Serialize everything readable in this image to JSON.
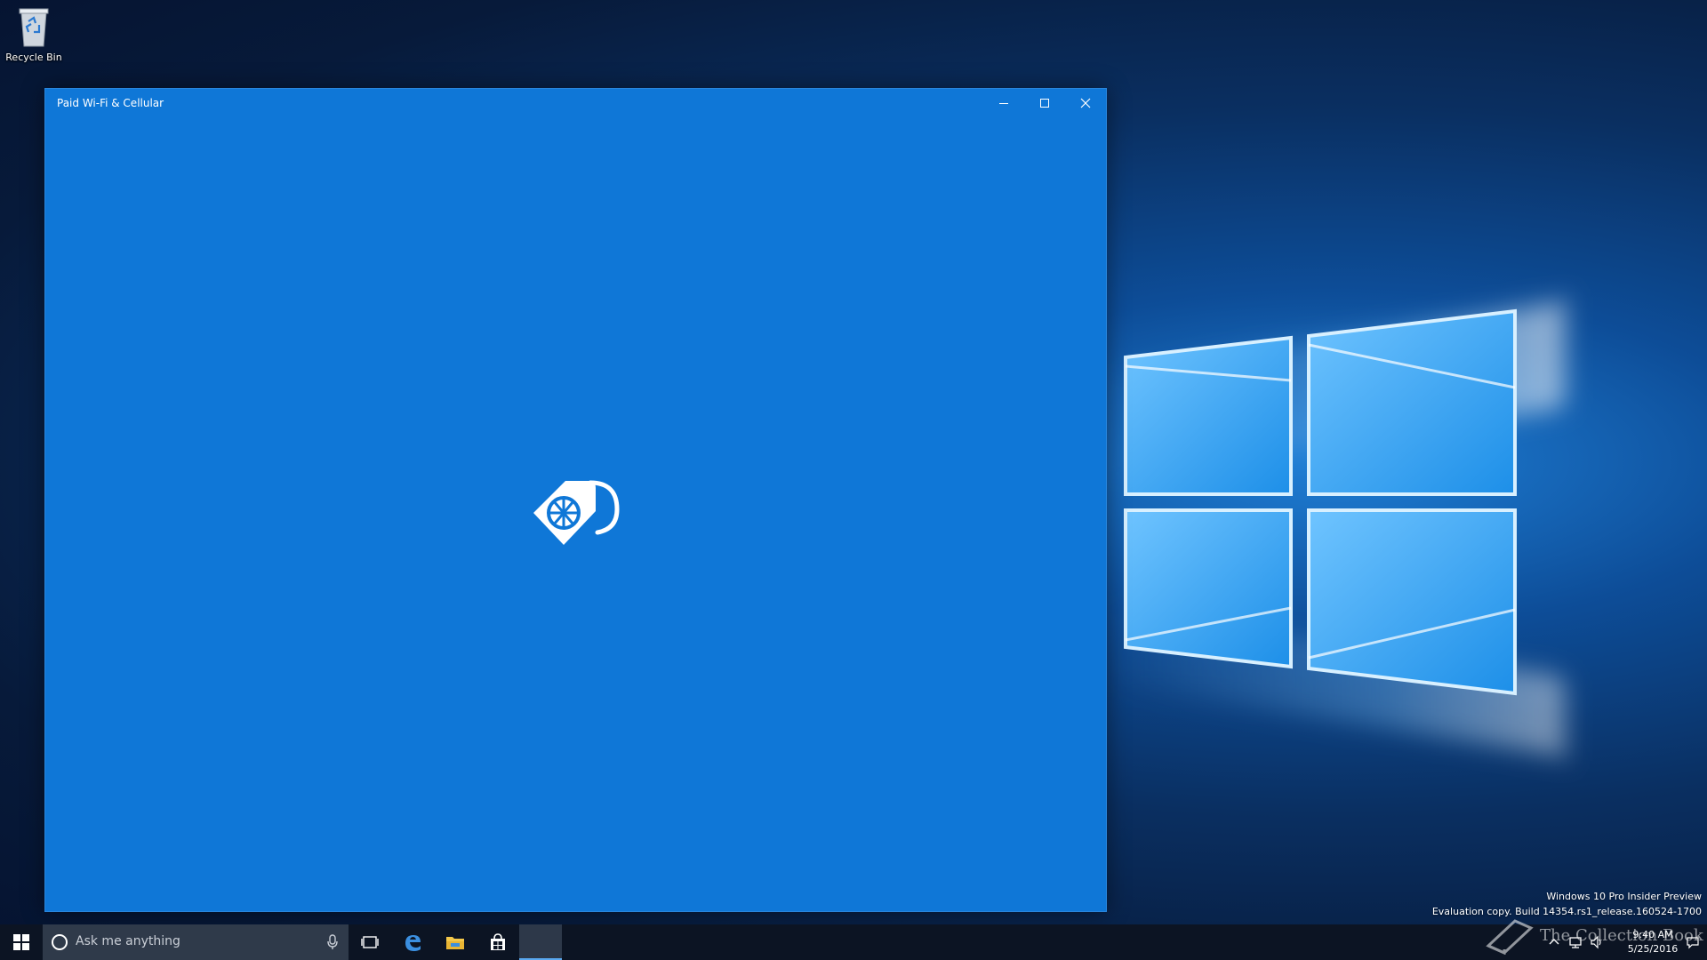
{
  "desktop": {
    "icons": [
      {
        "label": "Recycle Bin",
        "icon": "recycle-bin-icon"
      }
    ]
  },
  "window": {
    "title": "Paid Wi-Fi & Cellular",
    "app_icon": "paid-wifi-cellular-icon",
    "background_color": "#0f77d7",
    "controls": {
      "minimize": "minimize-icon",
      "maximize": "maximize-icon",
      "close": "close-icon"
    }
  },
  "taskbar": {
    "start_icon": "windows-start-icon",
    "search": {
      "placeholder": "Ask me anything",
      "icon": "cortana-icon",
      "mic_icon": "microphone-icon"
    },
    "pinned": [
      {
        "name": "Task View",
        "icon": "task-view-icon"
      },
      {
        "name": "Microsoft Edge",
        "icon": "edge-icon"
      },
      {
        "name": "File Explorer",
        "icon": "file-explorer-icon"
      },
      {
        "name": "Store",
        "icon": "store-icon"
      },
      {
        "name": "Paid Wi-Fi & Cellular",
        "icon": "app-running-icon",
        "active": true
      }
    ],
    "tray": {
      "icons": [
        "chevron-up-icon",
        "network-icon",
        "volume-icon"
      ],
      "time": "9:40 AM",
      "date": "5/25/2016",
      "action_center_icon": "action-center-icon"
    }
  },
  "watermark": {
    "line1": "Windows 10 Pro Insider Preview",
    "line2": "Evaluation copy. Build 14354.rs1_release.160524-1700"
  },
  "brand": {
    "text": "The Collection Book"
  }
}
